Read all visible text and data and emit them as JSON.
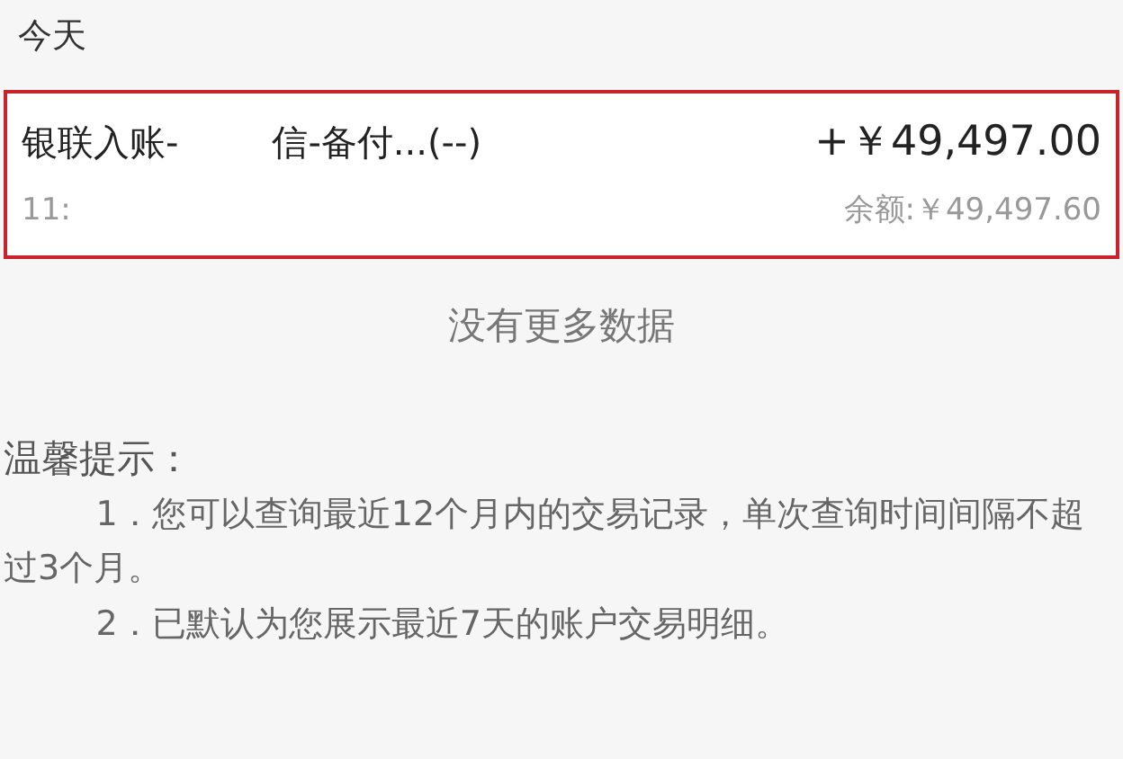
{
  "section_header": "今天",
  "transactions": [
    {
      "title_parts": [
        "银联入账-",
        "信-备付...(--)"
      ],
      "amount": "+￥49,497.00",
      "time": "11:",
      "balance": "余额:￥49,497.60",
      "highlighted": true
    }
  ],
  "no_more": "没有更多数据",
  "tips": {
    "title": "温馨提示：",
    "items": [
      "1．您可以查询最近12个月内的交易记录，单次查询时间间隔不超过3个月。",
      "2．已默认为您展示最近7天的账户交易明细。"
    ]
  }
}
